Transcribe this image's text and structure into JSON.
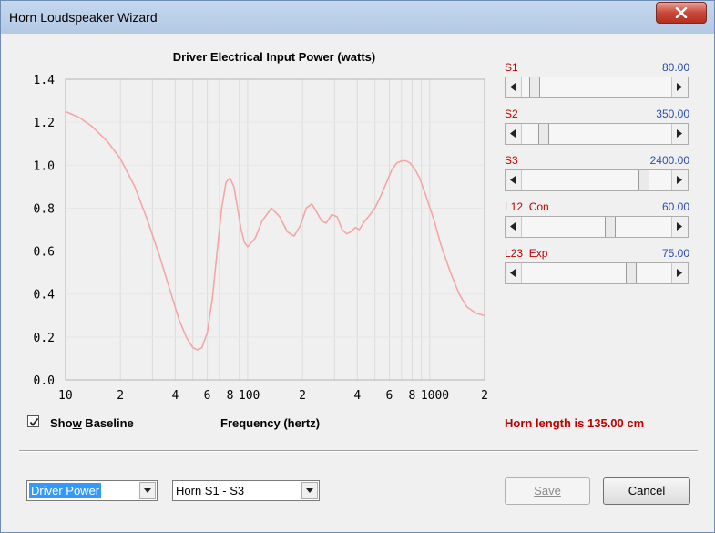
{
  "window": {
    "title": "Horn Loudspeaker Wizard"
  },
  "chart_data": {
    "type": "line",
    "title": "Driver Electrical Input Power (watts)",
    "xlabel": "Frequency (hertz)",
    "ylabel": "",
    "xscale": "log",
    "xlim": [
      10,
      2000
    ],
    "ylim": [
      0,
      1.4
    ],
    "yticks": [
      "0.0",
      "0.2",
      "0.4",
      "0.6",
      "0.8",
      "1.0",
      "1.2",
      "1.4"
    ],
    "xtick_labels": [
      {
        "value": 10,
        "label": "10"
      },
      {
        "value": 20,
        "label": "2"
      },
      {
        "value": 40,
        "label": "4"
      },
      {
        "value": 60,
        "label": "6"
      },
      {
        "value": 80,
        "label": "8"
      },
      {
        "value": 100,
        "label": "100"
      },
      {
        "value": 200,
        "label": "2"
      },
      {
        "value": 400,
        "label": "4"
      },
      {
        "value": 600,
        "label": "6"
      },
      {
        "value": 800,
        "label": "8"
      },
      {
        "value": 1000,
        "label": "1000"
      },
      {
        "value": 2000,
        "label": "2"
      }
    ],
    "grid": true,
    "line_color": "#f4a6a6",
    "series": [
      {
        "x": [
          10,
          12,
          14,
          17,
          20,
          24,
          28,
          33,
          38,
          42,
          46,
          50,
          53,
          56,
          60,
          64,
          68,
          72,
          76,
          80,
          84,
          88,
          92,
          96,
          100,
          110,
          120,
          135,
          150,
          165,
          180,
          195,
          210,
          225,
          240,
          255,
          270,
          290,
          310,
          330,
          350,
          370,
          390,
          410,
          440,
          470,
          500,
          540,
          580,
          620,
          660,
          700,
          740,
          780,
          830,
          880,
          950,
          1050,
          1150,
          1300,
          1450,
          1600,
          1800,
          2000
        ],
        "y": [
          1.25,
          1.22,
          1.18,
          1.11,
          1.03,
          0.9,
          0.75,
          0.57,
          0.4,
          0.28,
          0.2,
          0.15,
          0.14,
          0.15,
          0.22,
          0.38,
          0.6,
          0.8,
          0.92,
          0.94,
          0.9,
          0.8,
          0.7,
          0.64,
          0.62,
          0.66,
          0.74,
          0.8,
          0.76,
          0.69,
          0.67,
          0.72,
          0.8,
          0.82,
          0.78,
          0.74,
          0.73,
          0.77,
          0.76,
          0.7,
          0.68,
          0.69,
          0.71,
          0.7,
          0.74,
          0.77,
          0.8,
          0.86,
          0.92,
          0.98,
          1.01,
          1.02,
          1.02,
          1.01,
          0.98,
          0.94,
          0.86,
          0.75,
          0.63,
          0.5,
          0.4,
          0.34,
          0.31,
          0.3
        ]
      }
    ]
  },
  "sliders": [
    {
      "label": "S1",
      "value": "80.00",
      "fraction": 0.05
    },
    {
      "label": "S2",
      "value": "350.00",
      "fraction": 0.12
    },
    {
      "label": "S3",
      "value": "2400.00",
      "fraction": 0.84
    },
    {
      "label": "L12  Con",
      "value": "60.00",
      "fraction": 0.6
    },
    {
      "label": "L23  Exp",
      "value": "75.00",
      "fraction": 0.75
    }
  ],
  "baseline": {
    "label_pre": "Sho",
    "label_mnemonic": "w",
    "label_post": " Baseline",
    "checked": true
  },
  "horn_length": "Horn length is 135.00 cm",
  "plot_select": {
    "value": "Driver Power"
  },
  "horn_select": {
    "value": "Horn S1 - S3"
  },
  "buttons": {
    "save": "Save",
    "cancel": "Cancel"
  }
}
